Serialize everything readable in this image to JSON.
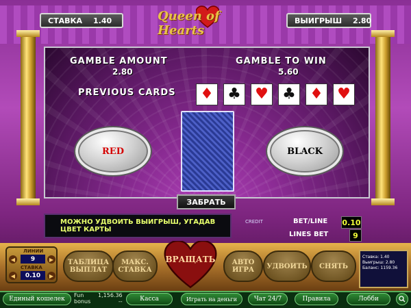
{
  "header": {
    "bet_label": "СТАВКА",
    "bet_value": "1.40",
    "win_label": "ВЫИГРЫШ",
    "win_value": "2.80",
    "logo_text": "Queen of Hearts"
  },
  "gamble": {
    "amount_label": "GAMBLE AMOUNT",
    "amount_value": "2.80",
    "towin_label": "GAMBLE TO WIN",
    "towin_value": "5.60",
    "previous_label": "PREVIOUS CARDS",
    "previous_cards": [
      {
        "suit": "diamonds",
        "symbol": "♦",
        "color": "#e01010"
      },
      {
        "suit": "clubs",
        "symbol": "♣",
        "color": "#111111"
      },
      {
        "suit": "hearts",
        "symbol": "♥",
        "color": "#e01010"
      },
      {
        "suit": "clubs",
        "symbol": "♣",
        "color": "#111111"
      },
      {
        "suit": "diamonds",
        "symbol": "♦",
        "color": "#e01010"
      },
      {
        "suit": "hearts",
        "symbol": "♥",
        "color": "#e01010"
      }
    ],
    "red_label": "RED",
    "black_label": "BLACK",
    "collect_label": "ЗАБРАТЬ"
  },
  "message": "МОЖНО УДВОИТЬ ВЫИГРЫШ, УГАДАВ ЦВЕТ КАРТЫ",
  "credit_label": "CREDIT",
  "betline": {
    "label": "BET/LINE",
    "value": "0.10"
  },
  "linesbet": {
    "label": "LINES BET",
    "value": "9"
  },
  "controls": {
    "lines_label": "ЛИНИИ",
    "lines_value": "9",
    "stake_label": "СТАВКА",
    "stake_value": "0.10",
    "paytable": "ТАБЛИЦА ВЫПЛАТ",
    "maxbet": "МАКС. СТАВКА",
    "spin": "ВРАЩАТЬ",
    "auto": "АВТО ИГРА",
    "double": "УДВОИТЬ",
    "take": "СНЯТЬ"
  },
  "summary": {
    "head": "",
    "stake": "Ставка: 1.40",
    "win": "Выигрыш: 2.80",
    "balance": "Баланс: 1159.36"
  },
  "statusbar": {
    "wallet": "Единый кошелек",
    "fun": "Fun",
    "bonus": "bonus",
    "amount": "1,156.36",
    "dash": "--",
    "cashier": "Касса",
    "play_money": "Играть на деньги",
    "chat": "Чат 24/7",
    "rules": "Правила",
    "lobby": "Лобби"
  },
  "colors": {
    "red_text": "#d40000",
    "black_text": "#000000",
    "digit_yellow": "#f2ff39"
  }
}
